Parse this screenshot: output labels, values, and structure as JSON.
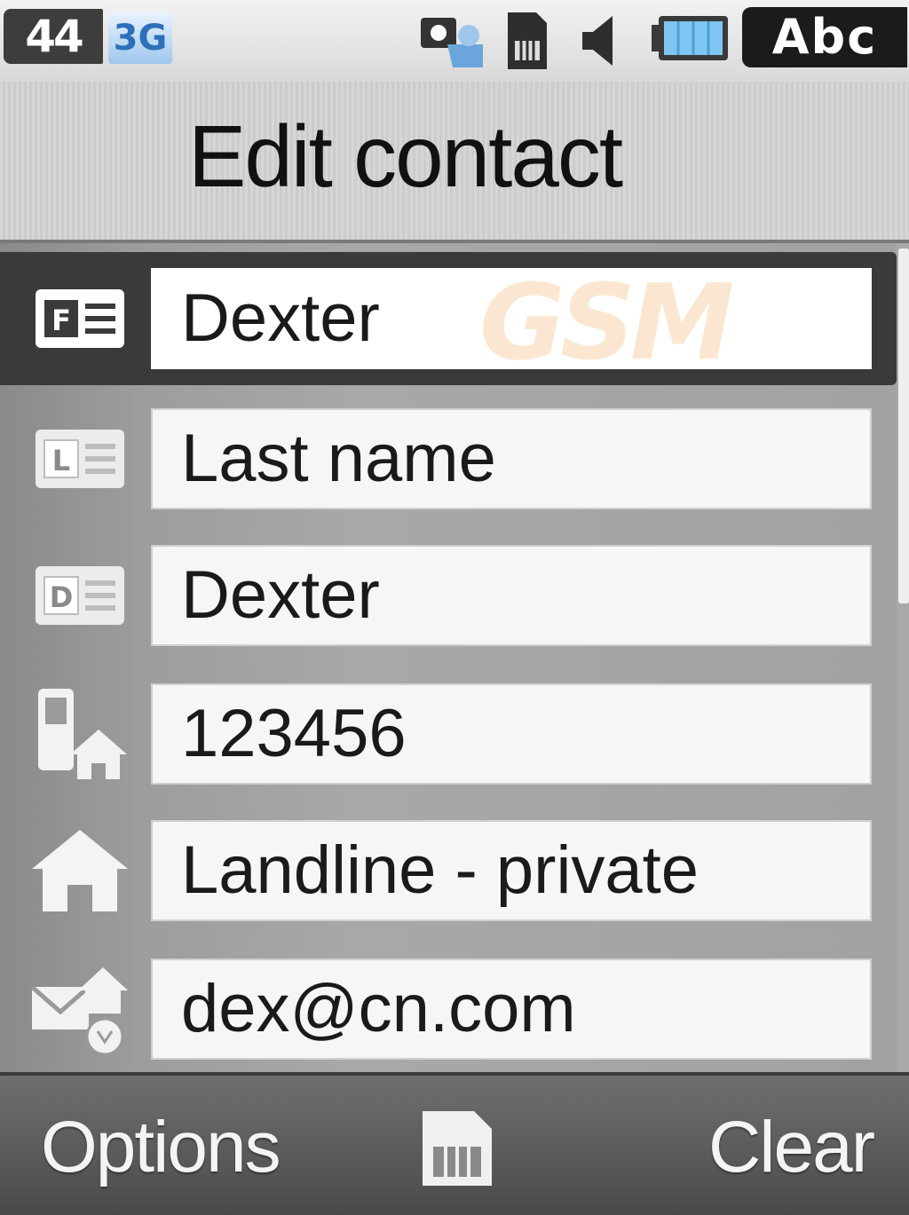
{
  "status_bar": {
    "signal_text": "44",
    "network_text": "3G",
    "icons": [
      "messenger-icon",
      "sim-card-icon",
      "speaker-icon",
      "battery-icon"
    ],
    "input_mode": "Abc"
  },
  "header": {
    "title": "Edit contact"
  },
  "fields": [
    {
      "icon": "first-name-card-icon",
      "value": "Dexter",
      "selected": true
    },
    {
      "icon": "last-name-card-icon",
      "value": "Last name",
      "selected": false
    },
    {
      "icon": "display-name-card-icon",
      "value": "Dexter",
      "selected": false
    },
    {
      "icon": "mobile-home-icon",
      "value": "123456",
      "selected": false
    },
    {
      "icon": "home-icon",
      "value": "Landline - private",
      "selected": false
    },
    {
      "icon": "email-home-icon",
      "value": "dex@cn.com",
      "selected": false
    }
  ],
  "watermark": "GSM",
  "softkeys": {
    "left": "Options",
    "center_icon": "sim-save-icon",
    "right": "Clear"
  },
  "colors": {
    "selected_row": "#3a3a3a",
    "field_bg": "#f6f6f6",
    "abc_badge": "#1b1b1b",
    "network_badge": "#2c70b8"
  }
}
